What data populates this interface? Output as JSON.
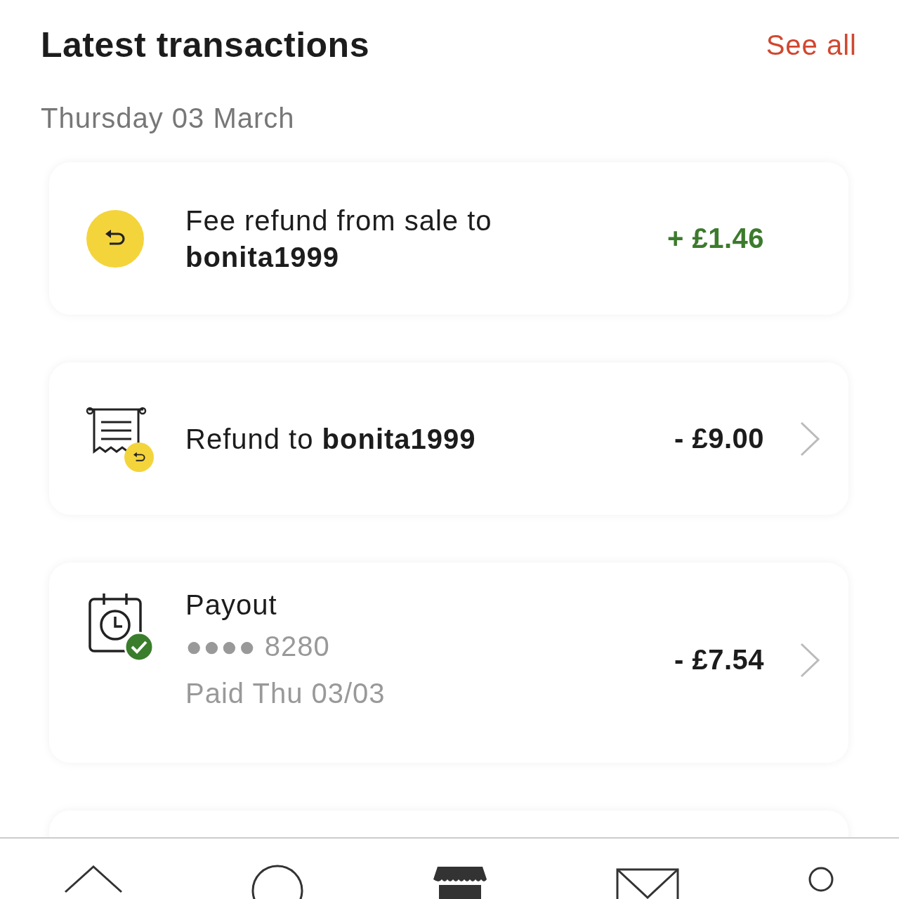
{
  "header": {
    "title": "Latest transactions",
    "link": "See all"
  },
  "date": "Thursday 03 March",
  "transactions": [
    {
      "kind": "refund",
      "title": "Fee refund from sale to\n**bonita1999**",
      "amount": "+ £1.46",
      "color": "#3c7a2c",
      "chevron": false
    },
    {
      "kind": "receipt",
      "title": "Refund to **bonita1999**",
      "amount": "- £9.00",
      "color": "#1c1c1c",
      "chevron": true
    },
    {
      "kind": "payout",
      "title": "Payout",
      "details": [
        "●●●● 8280",
        "Paid Thu 03/03"
      ],
      "amount": "- £7.54",
      "color": "#1c1c1c",
      "chevron": true
    }
  ]
}
